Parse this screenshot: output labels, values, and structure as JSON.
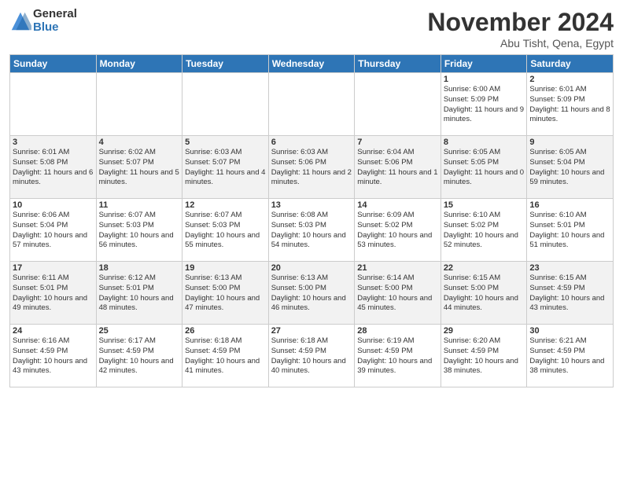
{
  "logo": {
    "text_general": "General",
    "text_blue": "Blue"
  },
  "header": {
    "month": "November 2024",
    "location": "Abu Tisht, Qena, Egypt"
  },
  "weekdays": [
    "Sunday",
    "Monday",
    "Tuesday",
    "Wednesday",
    "Thursday",
    "Friday",
    "Saturday"
  ],
  "weeks": [
    [
      {
        "day": "",
        "info": ""
      },
      {
        "day": "",
        "info": ""
      },
      {
        "day": "",
        "info": ""
      },
      {
        "day": "",
        "info": ""
      },
      {
        "day": "",
        "info": ""
      },
      {
        "day": "1",
        "info": "Sunrise: 6:00 AM\nSunset: 5:09 PM\nDaylight: 11 hours and 9 minutes."
      },
      {
        "day": "2",
        "info": "Sunrise: 6:01 AM\nSunset: 5:09 PM\nDaylight: 11 hours and 8 minutes."
      }
    ],
    [
      {
        "day": "3",
        "info": "Sunrise: 6:01 AM\nSunset: 5:08 PM\nDaylight: 11 hours and 6 minutes."
      },
      {
        "day": "4",
        "info": "Sunrise: 6:02 AM\nSunset: 5:07 PM\nDaylight: 11 hours and 5 minutes."
      },
      {
        "day": "5",
        "info": "Sunrise: 6:03 AM\nSunset: 5:07 PM\nDaylight: 11 hours and 4 minutes."
      },
      {
        "day": "6",
        "info": "Sunrise: 6:03 AM\nSunset: 5:06 PM\nDaylight: 11 hours and 2 minutes."
      },
      {
        "day": "7",
        "info": "Sunrise: 6:04 AM\nSunset: 5:06 PM\nDaylight: 11 hours and 1 minute."
      },
      {
        "day": "8",
        "info": "Sunrise: 6:05 AM\nSunset: 5:05 PM\nDaylight: 11 hours and 0 minutes."
      },
      {
        "day": "9",
        "info": "Sunrise: 6:05 AM\nSunset: 5:04 PM\nDaylight: 10 hours and 59 minutes."
      }
    ],
    [
      {
        "day": "10",
        "info": "Sunrise: 6:06 AM\nSunset: 5:04 PM\nDaylight: 10 hours and 57 minutes."
      },
      {
        "day": "11",
        "info": "Sunrise: 6:07 AM\nSunset: 5:03 PM\nDaylight: 10 hours and 56 minutes."
      },
      {
        "day": "12",
        "info": "Sunrise: 6:07 AM\nSunset: 5:03 PM\nDaylight: 10 hours and 55 minutes."
      },
      {
        "day": "13",
        "info": "Sunrise: 6:08 AM\nSunset: 5:03 PM\nDaylight: 10 hours and 54 minutes."
      },
      {
        "day": "14",
        "info": "Sunrise: 6:09 AM\nSunset: 5:02 PM\nDaylight: 10 hours and 53 minutes."
      },
      {
        "day": "15",
        "info": "Sunrise: 6:10 AM\nSunset: 5:02 PM\nDaylight: 10 hours and 52 minutes."
      },
      {
        "day": "16",
        "info": "Sunrise: 6:10 AM\nSunset: 5:01 PM\nDaylight: 10 hours and 51 minutes."
      }
    ],
    [
      {
        "day": "17",
        "info": "Sunrise: 6:11 AM\nSunset: 5:01 PM\nDaylight: 10 hours and 49 minutes."
      },
      {
        "day": "18",
        "info": "Sunrise: 6:12 AM\nSunset: 5:01 PM\nDaylight: 10 hours and 48 minutes."
      },
      {
        "day": "19",
        "info": "Sunrise: 6:13 AM\nSunset: 5:00 PM\nDaylight: 10 hours and 47 minutes."
      },
      {
        "day": "20",
        "info": "Sunrise: 6:13 AM\nSunset: 5:00 PM\nDaylight: 10 hours and 46 minutes."
      },
      {
        "day": "21",
        "info": "Sunrise: 6:14 AM\nSunset: 5:00 PM\nDaylight: 10 hours and 45 minutes."
      },
      {
        "day": "22",
        "info": "Sunrise: 6:15 AM\nSunset: 5:00 PM\nDaylight: 10 hours and 44 minutes."
      },
      {
        "day": "23",
        "info": "Sunrise: 6:15 AM\nSunset: 4:59 PM\nDaylight: 10 hours and 43 minutes."
      }
    ],
    [
      {
        "day": "24",
        "info": "Sunrise: 6:16 AM\nSunset: 4:59 PM\nDaylight: 10 hours and 43 minutes."
      },
      {
        "day": "25",
        "info": "Sunrise: 6:17 AM\nSunset: 4:59 PM\nDaylight: 10 hours and 42 minutes."
      },
      {
        "day": "26",
        "info": "Sunrise: 6:18 AM\nSunset: 4:59 PM\nDaylight: 10 hours and 41 minutes."
      },
      {
        "day": "27",
        "info": "Sunrise: 6:18 AM\nSunset: 4:59 PM\nDaylight: 10 hours and 40 minutes."
      },
      {
        "day": "28",
        "info": "Sunrise: 6:19 AM\nSunset: 4:59 PM\nDaylight: 10 hours and 39 minutes."
      },
      {
        "day": "29",
        "info": "Sunrise: 6:20 AM\nSunset: 4:59 PM\nDaylight: 10 hours and 38 minutes."
      },
      {
        "day": "30",
        "info": "Sunrise: 6:21 AM\nSunset: 4:59 PM\nDaylight: 10 hours and 38 minutes."
      }
    ]
  ]
}
